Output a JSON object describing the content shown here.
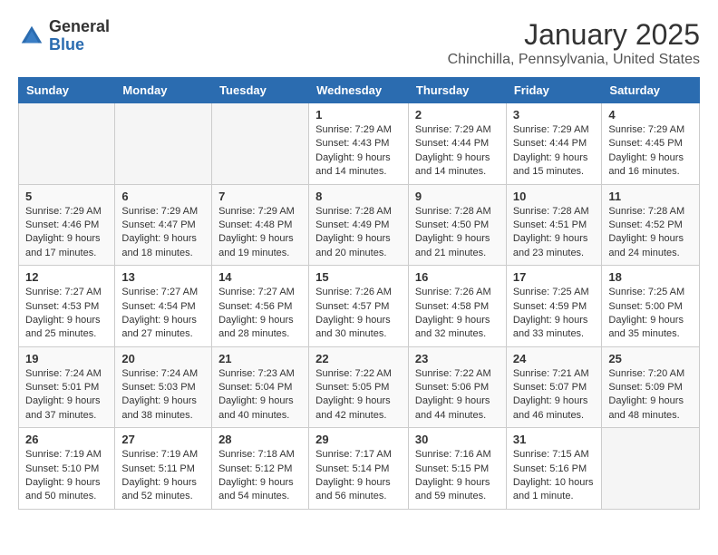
{
  "header": {
    "logo_general": "General",
    "logo_blue": "Blue",
    "month": "January 2025",
    "location": "Chinchilla, Pennsylvania, United States"
  },
  "weekdays": [
    "Sunday",
    "Monday",
    "Tuesday",
    "Wednesday",
    "Thursday",
    "Friday",
    "Saturday"
  ],
  "weeks": [
    [
      {
        "day": "",
        "content": ""
      },
      {
        "day": "",
        "content": ""
      },
      {
        "day": "",
        "content": ""
      },
      {
        "day": "1",
        "content": "Sunrise: 7:29 AM\nSunset: 4:43 PM\nDaylight: 9 hours and 14 minutes."
      },
      {
        "day": "2",
        "content": "Sunrise: 7:29 AM\nSunset: 4:44 PM\nDaylight: 9 hours and 14 minutes."
      },
      {
        "day": "3",
        "content": "Sunrise: 7:29 AM\nSunset: 4:44 PM\nDaylight: 9 hours and 15 minutes."
      },
      {
        "day": "4",
        "content": "Sunrise: 7:29 AM\nSunset: 4:45 PM\nDaylight: 9 hours and 16 minutes."
      }
    ],
    [
      {
        "day": "5",
        "content": "Sunrise: 7:29 AM\nSunset: 4:46 PM\nDaylight: 9 hours and 17 minutes."
      },
      {
        "day": "6",
        "content": "Sunrise: 7:29 AM\nSunset: 4:47 PM\nDaylight: 9 hours and 18 minutes."
      },
      {
        "day": "7",
        "content": "Sunrise: 7:29 AM\nSunset: 4:48 PM\nDaylight: 9 hours and 19 minutes."
      },
      {
        "day": "8",
        "content": "Sunrise: 7:28 AM\nSunset: 4:49 PM\nDaylight: 9 hours and 20 minutes."
      },
      {
        "day": "9",
        "content": "Sunrise: 7:28 AM\nSunset: 4:50 PM\nDaylight: 9 hours and 21 minutes."
      },
      {
        "day": "10",
        "content": "Sunrise: 7:28 AM\nSunset: 4:51 PM\nDaylight: 9 hours and 23 minutes."
      },
      {
        "day": "11",
        "content": "Sunrise: 7:28 AM\nSunset: 4:52 PM\nDaylight: 9 hours and 24 minutes."
      }
    ],
    [
      {
        "day": "12",
        "content": "Sunrise: 7:27 AM\nSunset: 4:53 PM\nDaylight: 9 hours and 25 minutes."
      },
      {
        "day": "13",
        "content": "Sunrise: 7:27 AM\nSunset: 4:54 PM\nDaylight: 9 hours and 27 minutes."
      },
      {
        "day": "14",
        "content": "Sunrise: 7:27 AM\nSunset: 4:56 PM\nDaylight: 9 hours and 28 minutes."
      },
      {
        "day": "15",
        "content": "Sunrise: 7:26 AM\nSunset: 4:57 PM\nDaylight: 9 hours and 30 minutes."
      },
      {
        "day": "16",
        "content": "Sunrise: 7:26 AM\nSunset: 4:58 PM\nDaylight: 9 hours and 32 minutes."
      },
      {
        "day": "17",
        "content": "Sunrise: 7:25 AM\nSunset: 4:59 PM\nDaylight: 9 hours and 33 minutes."
      },
      {
        "day": "18",
        "content": "Sunrise: 7:25 AM\nSunset: 5:00 PM\nDaylight: 9 hours and 35 minutes."
      }
    ],
    [
      {
        "day": "19",
        "content": "Sunrise: 7:24 AM\nSunset: 5:01 PM\nDaylight: 9 hours and 37 minutes."
      },
      {
        "day": "20",
        "content": "Sunrise: 7:24 AM\nSunset: 5:03 PM\nDaylight: 9 hours and 38 minutes."
      },
      {
        "day": "21",
        "content": "Sunrise: 7:23 AM\nSunset: 5:04 PM\nDaylight: 9 hours and 40 minutes."
      },
      {
        "day": "22",
        "content": "Sunrise: 7:22 AM\nSunset: 5:05 PM\nDaylight: 9 hours and 42 minutes."
      },
      {
        "day": "23",
        "content": "Sunrise: 7:22 AM\nSunset: 5:06 PM\nDaylight: 9 hours and 44 minutes."
      },
      {
        "day": "24",
        "content": "Sunrise: 7:21 AM\nSunset: 5:07 PM\nDaylight: 9 hours and 46 minutes."
      },
      {
        "day": "25",
        "content": "Sunrise: 7:20 AM\nSunset: 5:09 PM\nDaylight: 9 hours and 48 minutes."
      }
    ],
    [
      {
        "day": "26",
        "content": "Sunrise: 7:19 AM\nSunset: 5:10 PM\nDaylight: 9 hours and 50 minutes."
      },
      {
        "day": "27",
        "content": "Sunrise: 7:19 AM\nSunset: 5:11 PM\nDaylight: 9 hours and 52 minutes."
      },
      {
        "day": "28",
        "content": "Sunrise: 7:18 AM\nSunset: 5:12 PM\nDaylight: 9 hours and 54 minutes."
      },
      {
        "day": "29",
        "content": "Sunrise: 7:17 AM\nSunset: 5:14 PM\nDaylight: 9 hours and 56 minutes."
      },
      {
        "day": "30",
        "content": "Sunrise: 7:16 AM\nSunset: 5:15 PM\nDaylight: 9 hours and 59 minutes."
      },
      {
        "day": "31",
        "content": "Sunrise: 7:15 AM\nSunset: 5:16 PM\nDaylight: 10 hours and 1 minute."
      },
      {
        "day": "",
        "content": ""
      }
    ]
  ]
}
